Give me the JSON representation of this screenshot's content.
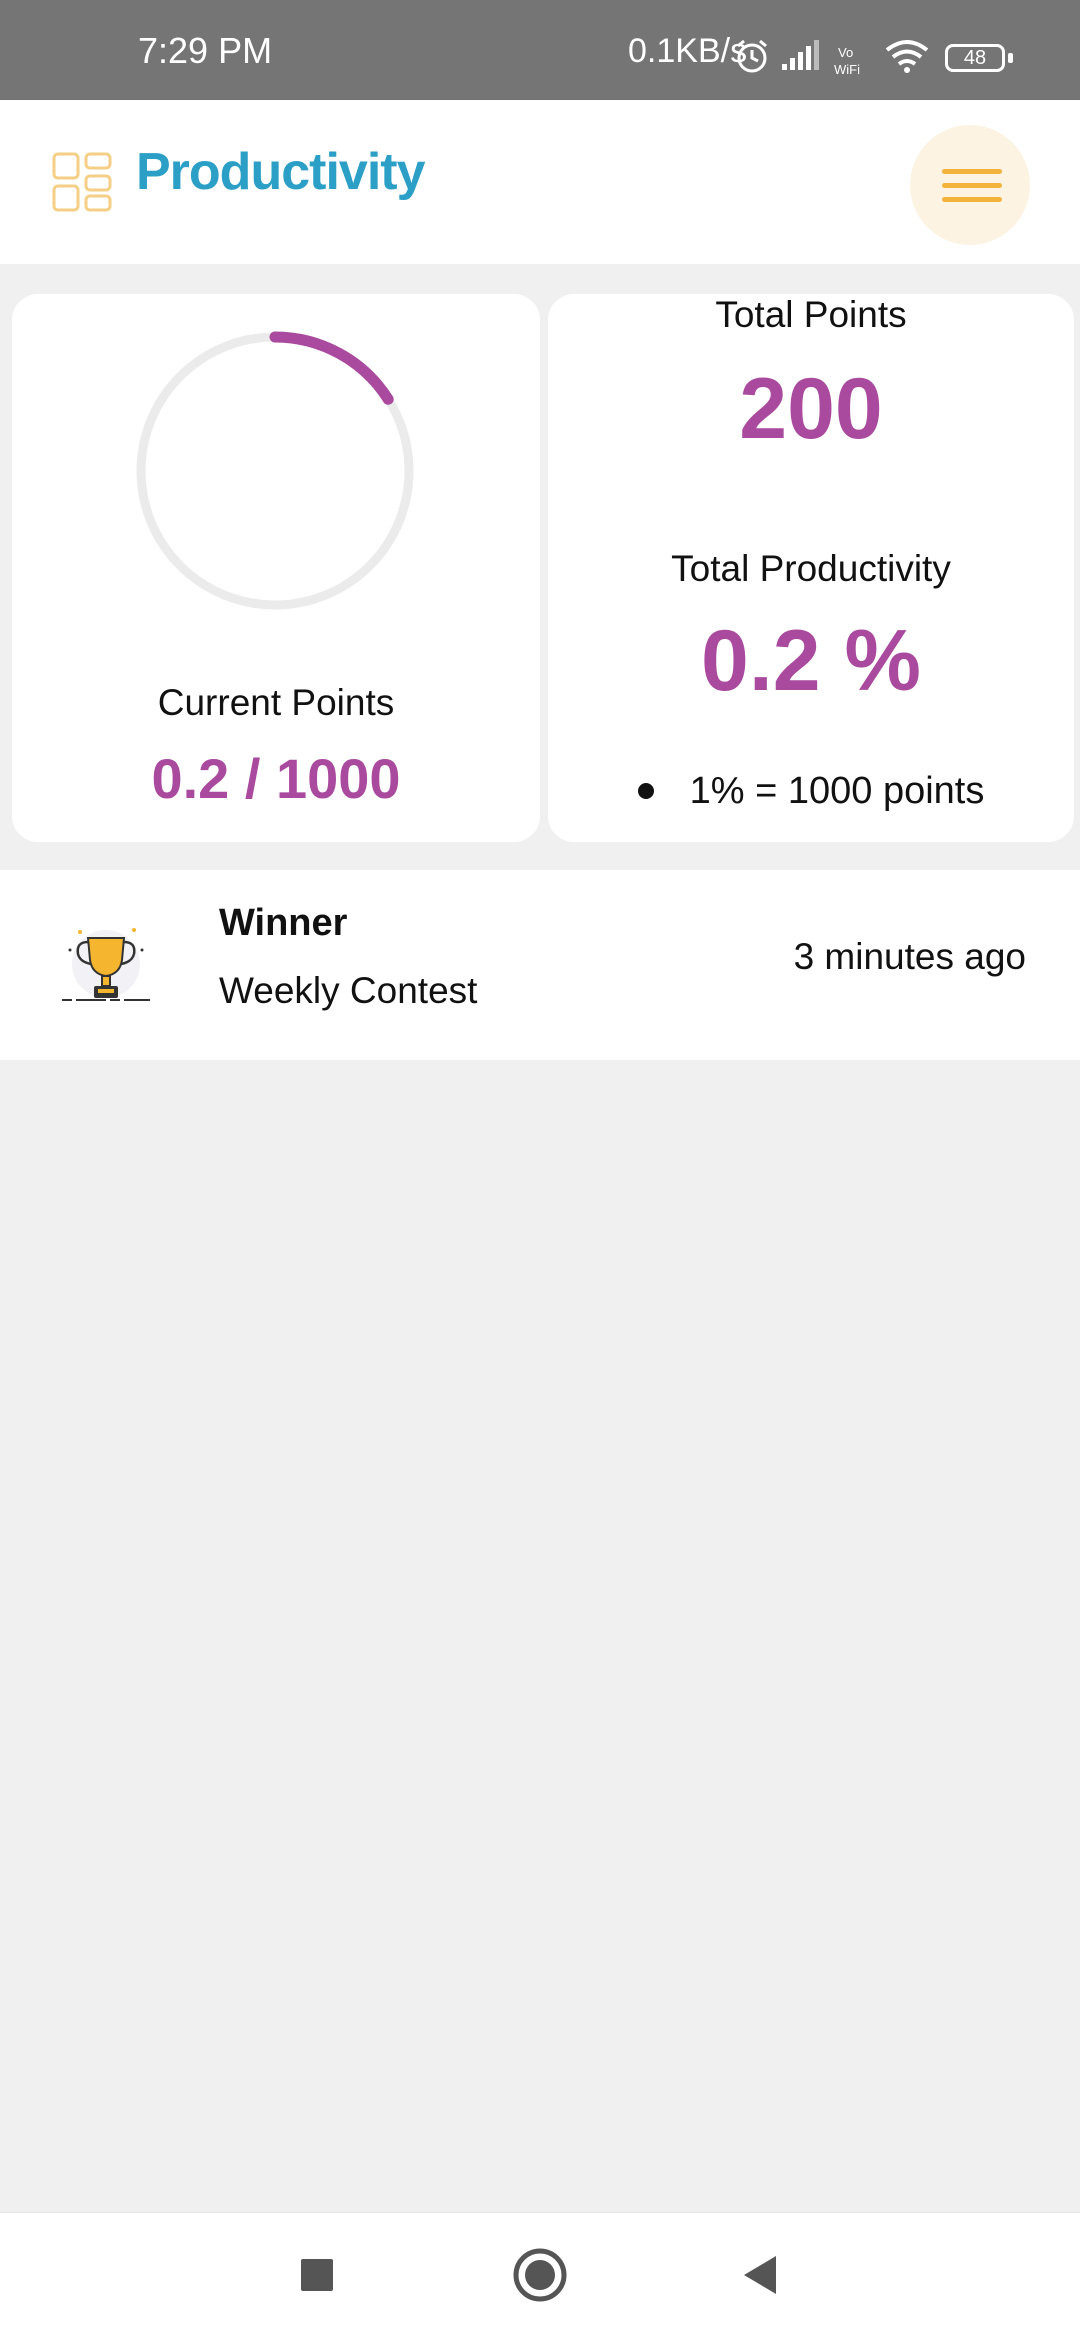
{
  "status_bar": {
    "time": "7:29 PM",
    "net_speed": "0.1KB/s",
    "battery": "48",
    "icons": [
      "alarm-icon",
      "signal-icon",
      "vowifi-icon",
      "wifi-icon",
      "battery-icon"
    ]
  },
  "header": {
    "title": "Productivity",
    "logo_icon": "grid-icon",
    "menu_icon": "hamburger-menu-icon"
  },
  "current_points_card": {
    "label": "Current Points",
    "value": "0.2 / 1000",
    "ring_progress_percent": 16
  },
  "totals_card": {
    "total_points_label": "Total Points",
    "total_points_value": "200",
    "total_productivity_label": "Total Productivity",
    "total_productivity_value": "0.2 %",
    "note": "1% = 1000 points"
  },
  "activity": {
    "icon": "trophy-icon",
    "title": "Winner",
    "subtitle": "Weekly Contest",
    "time": "3 minutes ago"
  },
  "nav": {
    "items": [
      "recents-square-icon",
      "home-circle-icon",
      "back-triangle-icon"
    ]
  },
  "colors": {
    "accent_purple": "#a94a9e",
    "title_blue": "#2b9fc6",
    "menu_orange": "#f3b23a",
    "background": "#f0f0f0"
  }
}
